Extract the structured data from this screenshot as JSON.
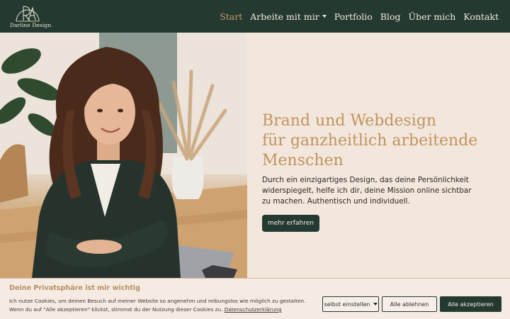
{
  "brand": {
    "name": "Darline Design"
  },
  "nav": {
    "items": [
      {
        "label": "Start",
        "active": true
      },
      {
        "label": "Arbeite mit mir",
        "has_dropdown": true
      },
      {
        "label": "Portfolio"
      },
      {
        "label": "Blog"
      },
      {
        "label": "Über mich"
      },
      {
        "label": "Kontakt"
      }
    ]
  },
  "hero": {
    "title_lines": [
      "Brand und Webdesign",
      "für ganzheitlich arbeitende",
      "Menschen"
    ],
    "description": "Durch ein einzigartiges Design, das deine Persönlichkeit widerspiegelt, helfe ich dir, deine Mission online sichtbar zu machen. Authentisch und individuell.",
    "cta_label": "mehr erfahren"
  },
  "cookie": {
    "title": "Deine Privatsphäre ist mir wichtig",
    "text": "Ich nutze Cookies, um deinen Besuch auf meiner Website so angenehm und reibungslos wie möglich zu gestalten. Wenn du auf \"Alle akzeptieren\" klickst, stimmst du der Nutzung dieser Cookies zu.",
    "link_label": "Datenschutzerklärung",
    "settings_label": "selbst einstellen",
    "deny_label": "Alle ablehnen",
    "accept_label": "Alle akzeptieren"
  },
  "colors": {
    "header_bg": "#243a31",
    "accent": "#c0945f",
    "page_bg": "#f3e6dc",
    "button_bg": "#243a31"
  }
}
